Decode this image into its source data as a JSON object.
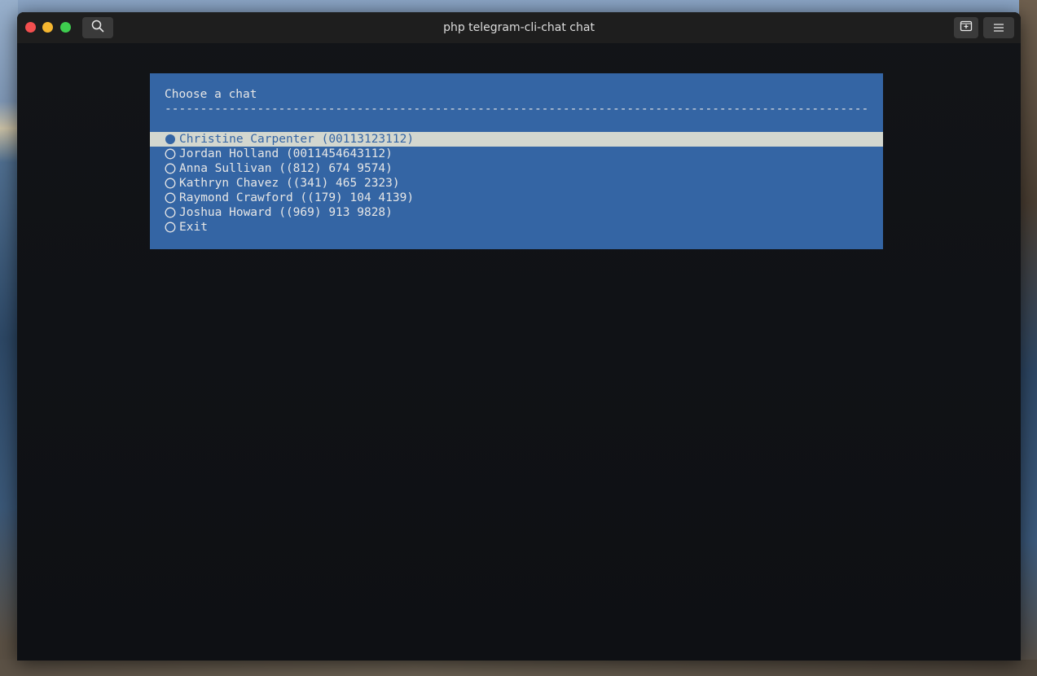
{
  "window": {
    "title": "php telegram-cli-chat chat"
  },
  "icons": {
    "search": "search-icon",
    "new_tab": "new-tab-icon",
    "menu": "hamburger-menu-icon"
  },
  "colors": {
    "dialog_bg": "#3465a4",
    "dialog_text": "#e6e6e6",
    "selected_bg": "#d3d7cf",
    "selected_text": "#3465a4"
  },
  "dialog": {
    "title": "Choose a chat",
    "separator": "----------------------------------------------------------------------------------------------------",
    "options": [
      {
        "label": "Christine Carpenter (00113123112)",
        "selected": true
      },
      {
        "label": "Jordan Holland (0011454643112)",
        "selected": false
      },
      {
        "label": "Anna Sullivan ((812) 674 9574)",
        "selected": false
      },
      {
        "label": "Kathryn Chavez ((341) 465 2323)",
        "selected": false
      },
      {
        "label": "Raymond Crawford ((179) 104 4139)",
        "selected": false
      },
      {
        "label": "Joshua Howard ((969) 913 9828)",
        "selected": false
      },
      {
        "label": "Exit",
        "selected": false
      }
    ]
  }
}
